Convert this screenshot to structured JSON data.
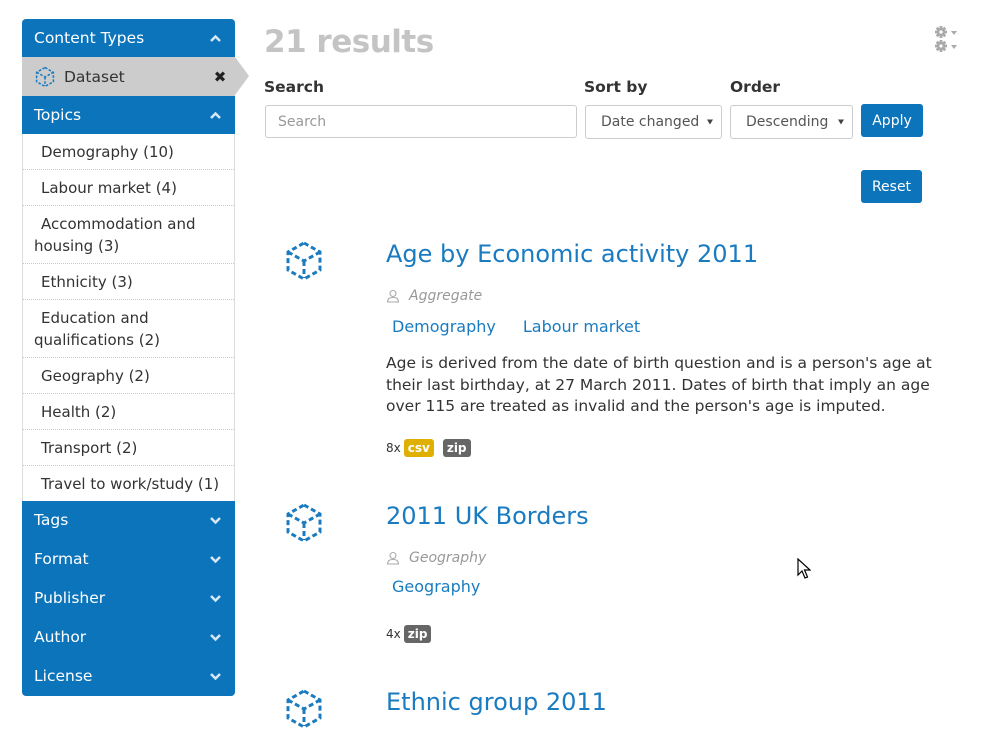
{
  "sidebar": {
    "content_types": {
      "title": "Content Types",
      "active_filter": {
        "label": "Dataset",
        "icon": "cube-icon",
        "remove_icon": "close-icon"
      }
    },
    "topics": {
      "title": "Topics",
      "items": [
        {
          "label": "Demography (10)"
        },
        {
          "label": "Labour market (4)"
        },
        {
          "label": "Accommodation and housing (3)"
        },
        {
          "label": "Ethnicity (3)"
        },
        {
          "label": "Education and qualifications (2)"
        },
        {
          "label": "Geography (2)"
        },
        {
          "label": "Health (2)"
        },
        {
          "label": "Transport (2)"
        },
        {
          "label": "Travel to work/study (1)"
        }
      ]
    },
    "collapsed_facets": [
      {
        "label": "Tags"
      },
      {
        "label": "Format"
      },
      {
        "label": "Publisher"
      },
      {
        "label": "Author"
      },
      {
        "label": "License"
      }
    ]
  },
  "header": {
    "results_count": "21 results",
    "settings_icon": "gear-dropdown-icon"
  },
  "search_form": {
    "search_label": "Search",
    "search_placeholder": "Search",
    "search_value": "",
    "sort_label": "Sort by",
    "sort_value": "Date changed",
    "order_label": "Order",
    "order_value": "Descending",
    "apply_label": "Apply",
    "reset_label": "Reset"
  },
  "results": [
    {
      "title": "Age by Economic activity 2011",
      "publisher": "Aggregate",
      "topics": [
        "Demography",
        "Labour market"
      ],
      "description": "Age is derived from the date of birth question and is a person's age at their last birthday, at 27 March 2011. Dates of birth that imply an age over 115 are treated as invalid and the person's age is imputed.",
      "format_count": "8x",
      "formats": [
        {
          "label": "csv",
          "color": "#dfb000"
        },
        {
          "label": "zip",
          "color": "#666666"
        }
      ]
    },
    {
      "title": "2011 UK Borders",
      "publisher": "Geography",
      "topics": [
        "Geography"
      ],
      "description": "",
      "format_count": "4x",
      "formats": [
        {
          "label": "zip",
          "color": "#666666"
        }
      ]
    },
    {
      "title": "Ethnic group 2011"
    }
  ],
  "colors": {
    "brand_blue": "#0b74bb",
    "link_blue": "#1a7bc0",
    "muted_gray": "#c4c4c4"
  }
}
